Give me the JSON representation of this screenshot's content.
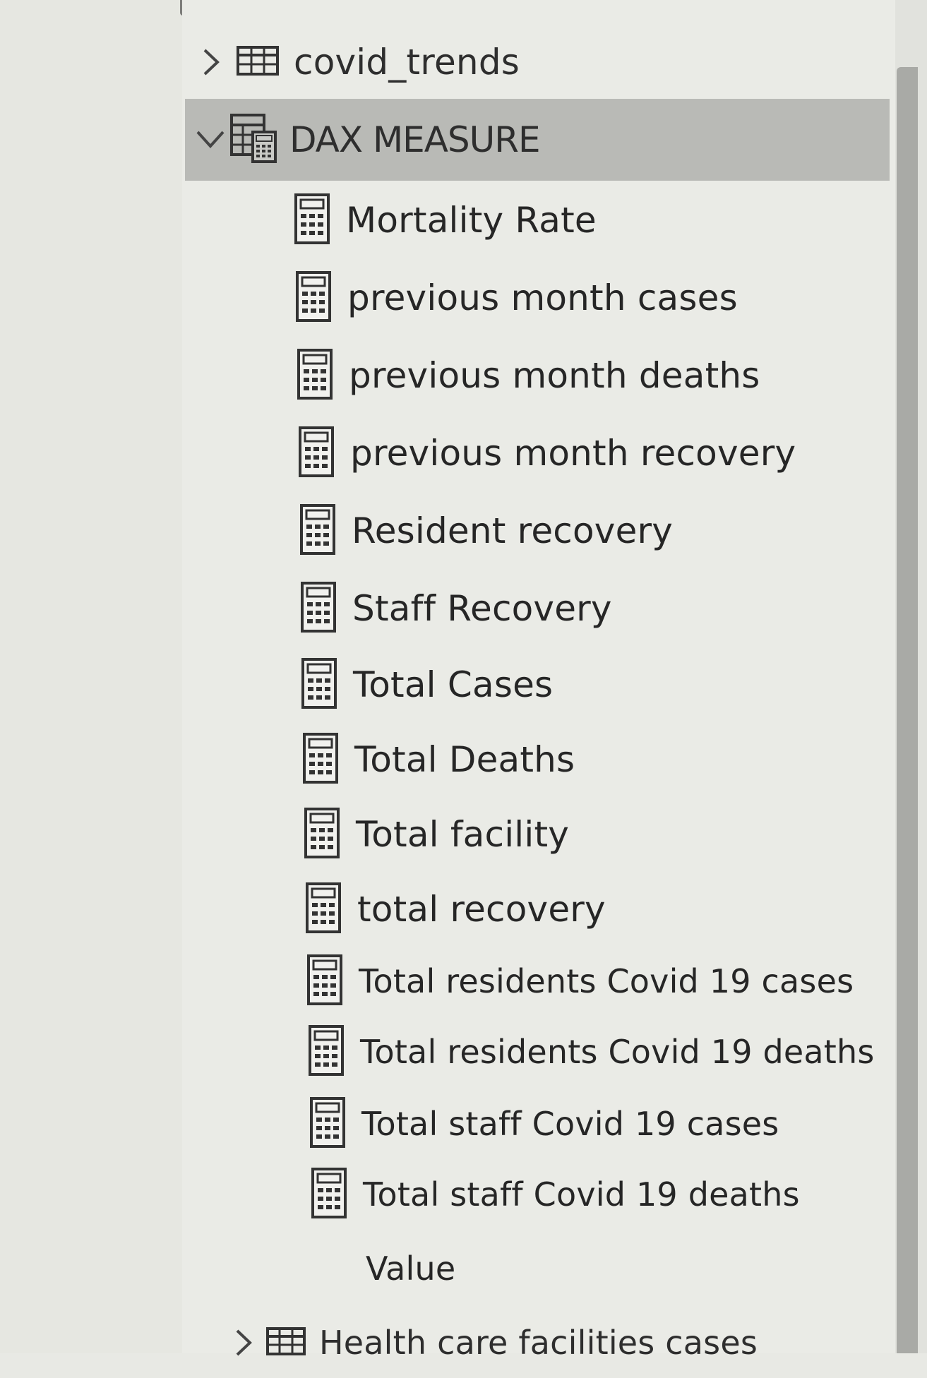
{
  "tree": {
    "tables": [
      {
        "name": "covid_trends",
        "expanded": false
      },
      {
        "name": "DAX MEASURE",
        "expanded": true,
        "selected": true
      },
      {
        "name": "Health care facilities cases",
        "expanded": false
      }
    ],
    "dax_measures": [
      "Mortality Rate",
      "previous month cases",
      "previous month deaths",
      "previous month recovery",
      "Resident recovery",
      "Staff Recovery",
      "Total Cases",
      "Total Deaths",
      "Total facility",
      "total recovery",
      "Total residents Covid 19 cases",
      "Total residents Covid 19 deaths",
      "Total staff Covid 19 cases",
      "Total staff Covid 19 deaths"
    ],
    "dax_field": "Value"
  },
  "icons": {
    "table": "table-grid-icon",
    "measure_table": "measure-table-icon",
    "measure": "calculator-icon",
    "collapsed": "chevron-right-icon",
    "expanded": "chevron-down-icon"
  },
  "colors": {
    "pane_background": "#eaebe6",
    "selected_row": "#b9bab6",
    "scrollbar_thumb": "#a9aaa6",
    "text": "#262626"
  }
}
